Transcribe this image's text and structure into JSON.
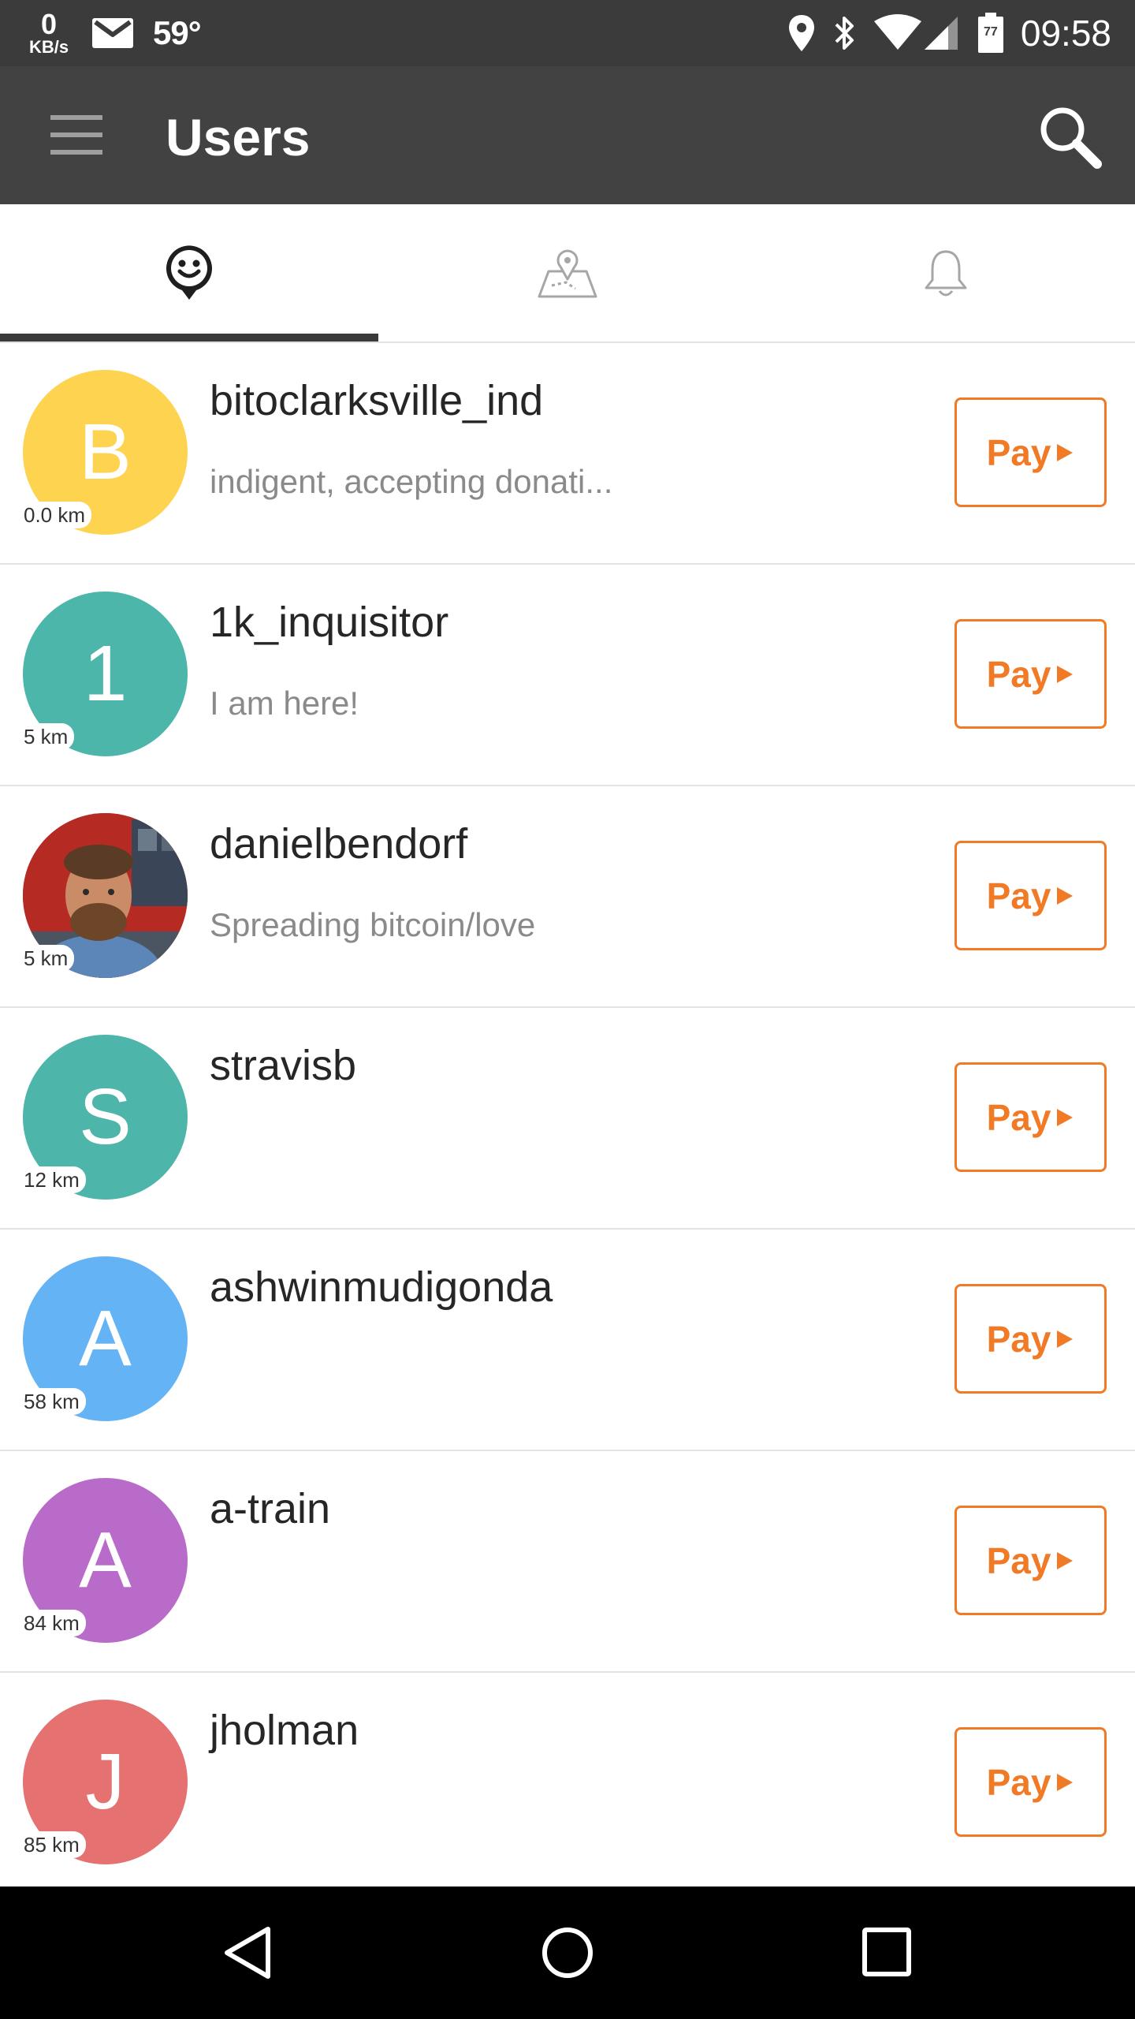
{
  "status_bar": {
    "net_speed_value": "0",
    "net_speed_unit": "KB/s",
    "temperature": "59°",
    "battery_level": "77",
    "time": "09:58"
  },
  "toolbar": {
    "title": "Users"
  },
  "tabs": [
    {
      "name": "users",
      "icon": "smiley-icon",
      "active": true
    },
    {
      "name": "map",
      "icon": "map-pin-icon",
      "active": false
    },
    {
      "name": "notifications",
      "icon": "bell-icon",
      "active": false
    }
  ],
  "colors": {
    "accent": "#f07a26",
    "toolbar": "#424242",
    "status_bar": "#3b3b3b"
  },
  "users": [
    {
      "initial": "B",
      "avatar_color": "#fdd34f",
      "distance": "0.0 km",
      "username": "bitoclarksville_ind",
      "status": "indigent, accepting donati...",
      "pay_label": "Pay"
    },
    {
      "initial": "1",
      "avatar_color": "#4cb6aa",
      "distance": "5 km",
      "username": "1k_inquisitor",
      "status": "I am here!",
      "pay_label": "Pay"
    },
    {
      "initial": "",
      "avatar_color": "#b52a22",
      "photo": true,
      "distance": "5 km",
      "username": "danielbendorf",
      "status": "Spreading bitcoin/love",
      "pay_label": "Pay"
    },
    {
      "initial": "S",
      "avatar_color": "#4db5aa",
      "distance": "12 km",
      "username": "stravisb",
      "status": "",
      "pay_label": "Pay"
    },
    {
      "initial": "A",
      "avatar_color": "#64b3f4",
      "distance": "58 km",
      "username": "ashwinmudigonda",
      "status": "",
      "pay_label": "Pay"
    },
    {
      "initial": "A",
      "avatar_color": "#b96bca",
      "distance": "84 km",
      "username": "a-train",
      "status": "",
      "pay_label": "Pay"
    },
    {
      "initial": "J",
      "avatar_color": "#e57171",
      "distance": "85 km",
      "username": "jholman",
      "status": "",
      "pay_label": "Pay"
    }
  ]
}
